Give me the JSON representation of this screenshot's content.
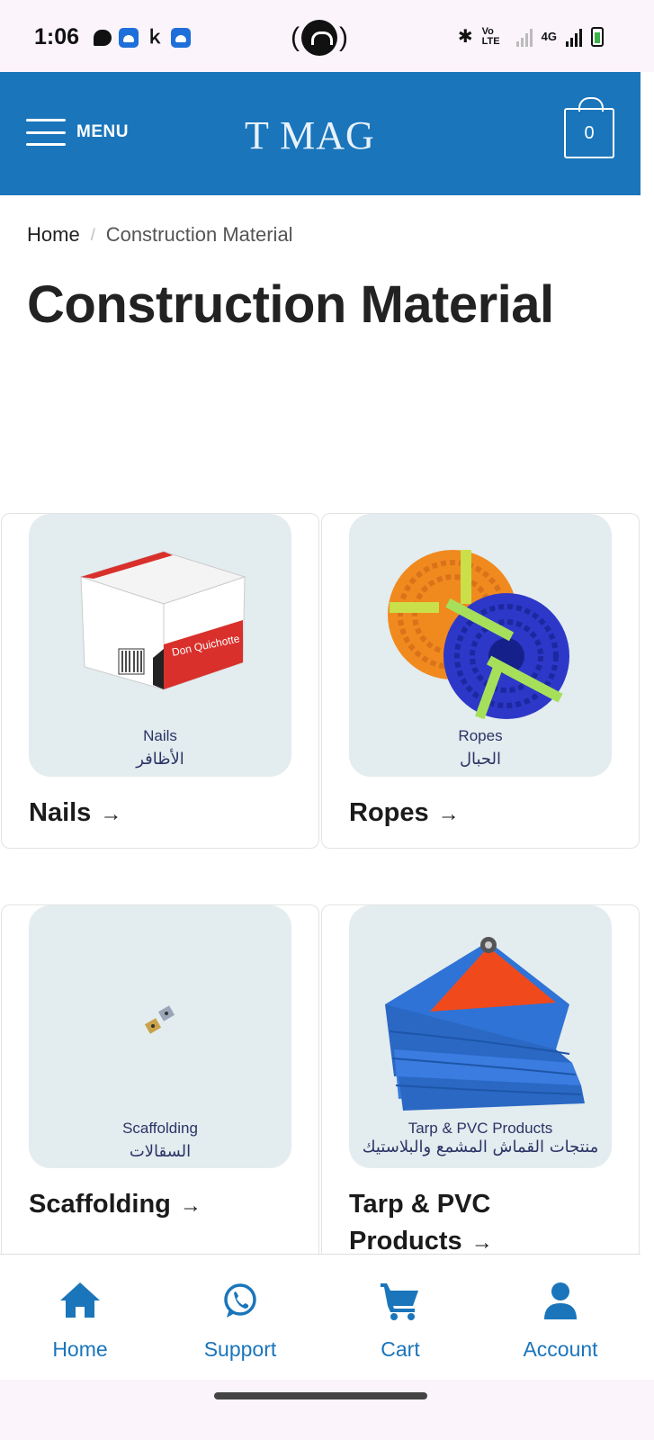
{
  "status_bar": {
    "time": "1:06",
    "network_label": "4G",
    "volte_label": "Vo LTE"
  },
  "header": {
    "menu_label": "MENU",
    "logo": "T MAG",
    "cart_count": "0",
    "background": "#1a75bb"
  },
  "breadcrumb": {
    "home": "Home",
    "separator": "/",
    "current": "Construction Material"
  },
  "page_title": "Construction Material",
  "categories": [
    {
      "title": "Nails",
      "image_label_en": "Nails",
      "image_label_ar": "الأظافر",
      "image": "nails-box"
    },
    {
      "title": "Ropes",
      "image_label_en": "Ropes",
      "image_label_ar": "الحبال",
      "image": "rope-coils"
    },
    {
      "title": "Scaffolding",
      "image_label_en": "Scaffolding",
      "image_label_ar": "السقالات",
      "image": "scaffolding-clamps"
    },
    {
      "title": "Tarp & PVC Products",
      "image_label_en": "Tarp & PVC Products",
      "image_label_ar": "منتجات القماش المشمع والبلاستيك",
      "image": "folded-tarp"
    }
  ],
  "arrow": "→",
  "bottom_nav": [
    {
      "label": "Home",
      "icon": "home-icon"
    },
    {
      "label": "Support",
      "icon": "whatsapp-icon"
    },
    {
      "label": "Cart",
      "icon": "cart-icon"
    },
    {
      "label": "Account",
      "icon": "account-icon"
    }
  ],
  "accent_color": "#1a75bb"
}
